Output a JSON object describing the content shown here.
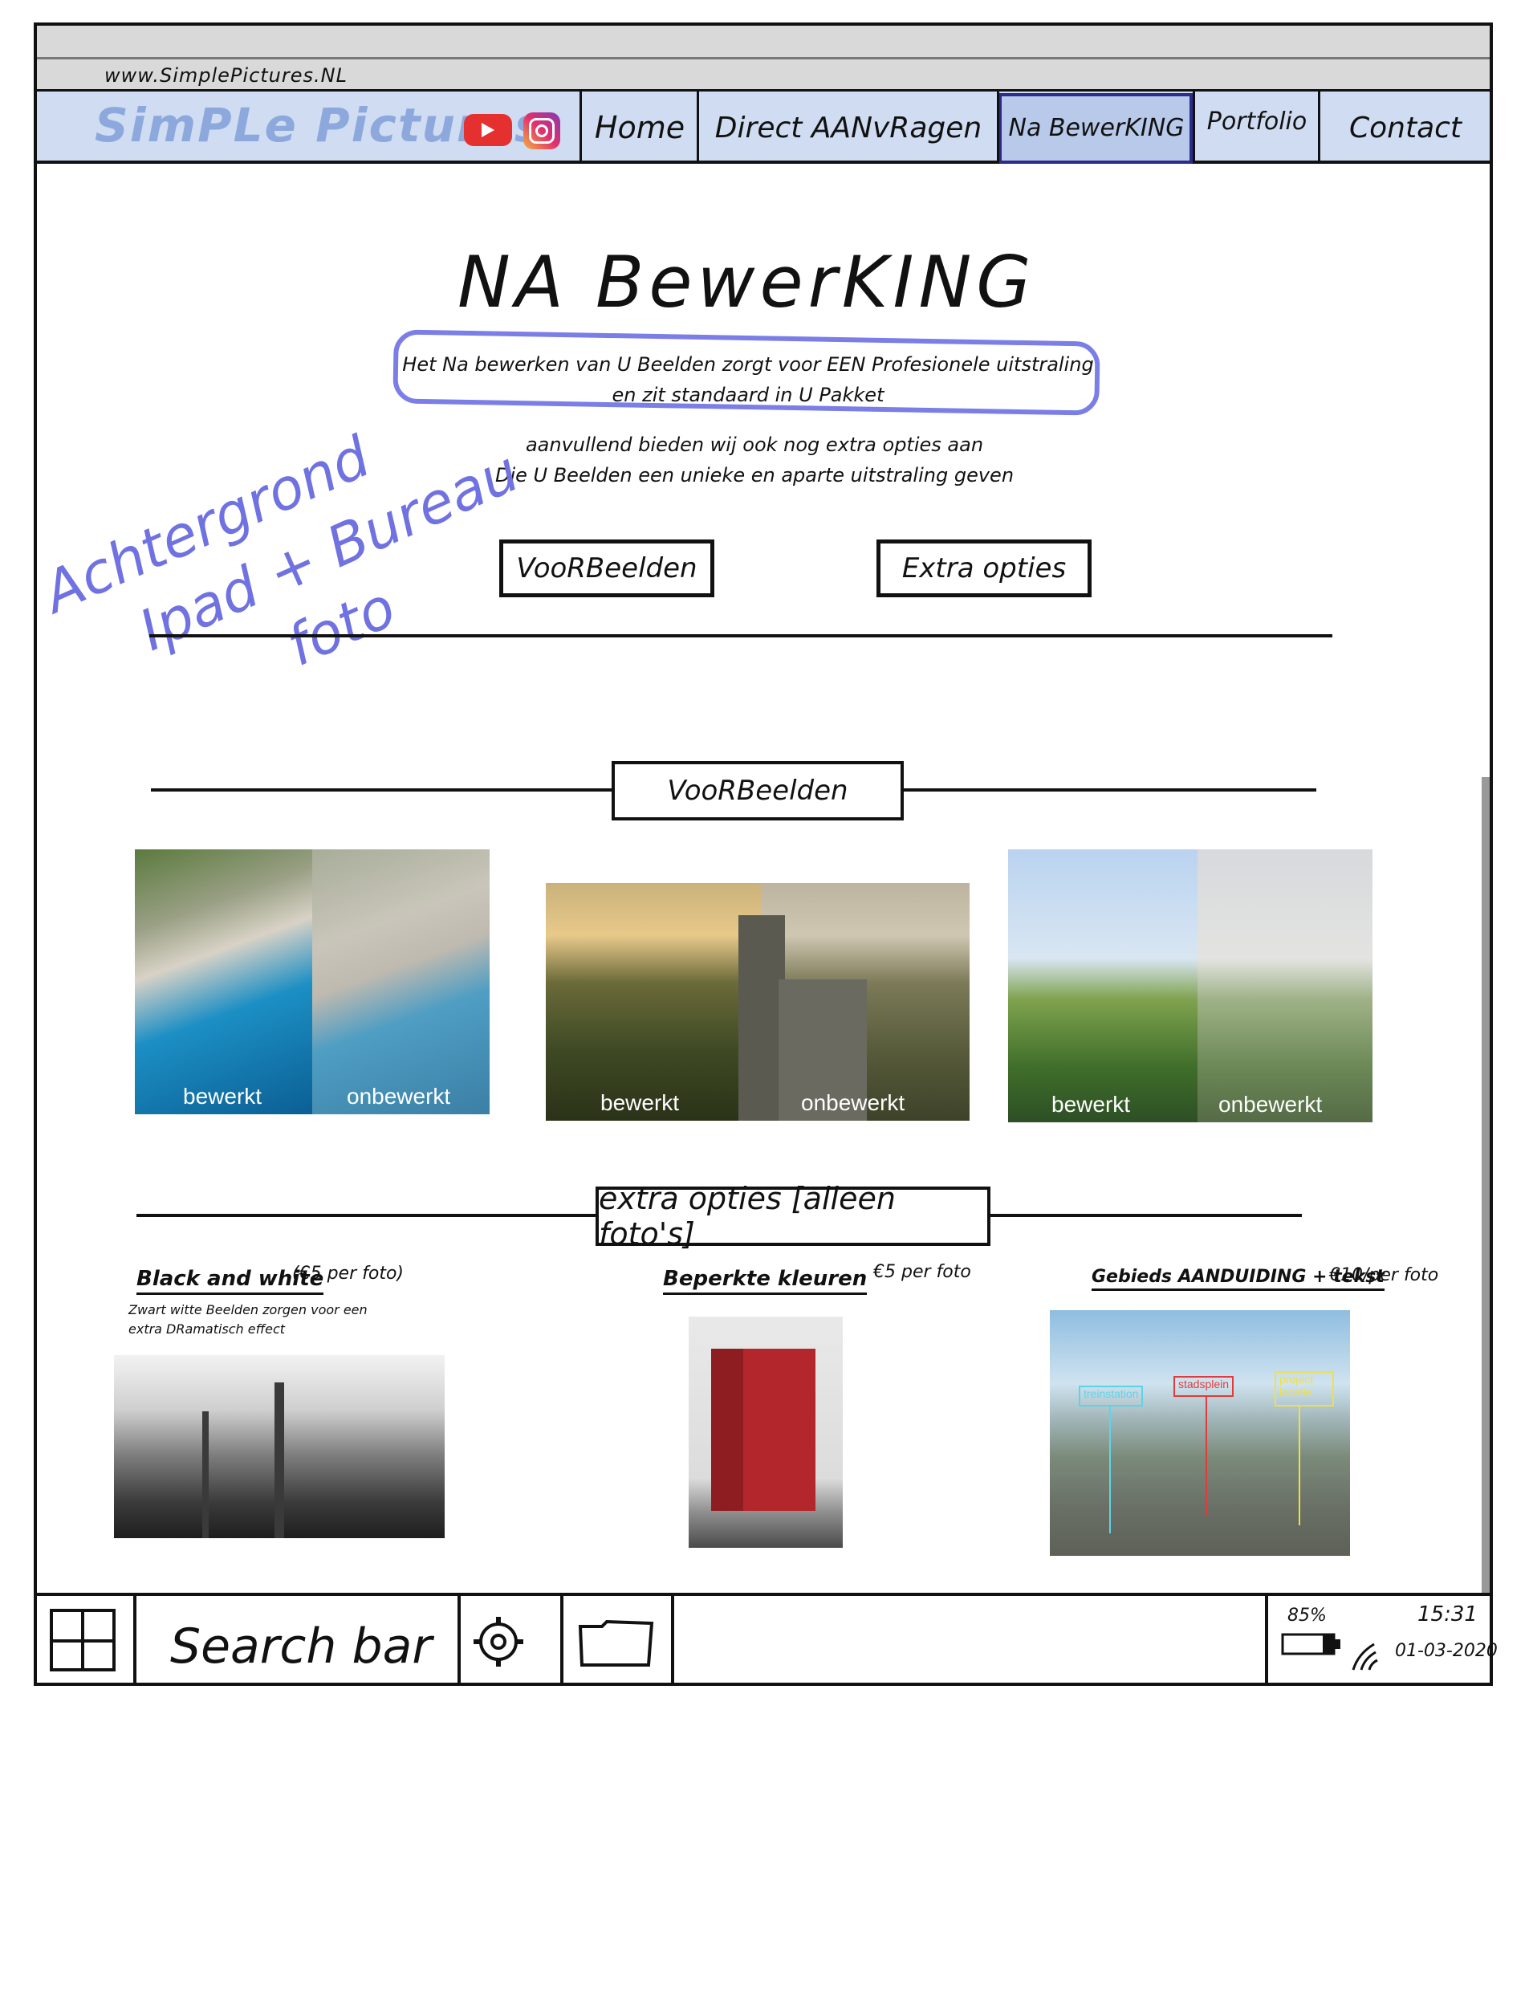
{
  "browser": {
    "url": "www.SimplePictures.NL"
  },
  "nav": {
    "logo": "SimPLe Pictures",
    "youtube_icon": "youtube-icon",
    "instagram_icon": "instagram-icon",
    "items": [
      "Home",
      "Direct AANvRagen",
      "Na BewerKING",
      "Portfolio",
      "Contact"
    ],
    "active_index": 2,
    "colors": {
      "bar": "#cfdcf1",
      "logo": "#8da8dc",
      "active_border": "#2b2b8c"
    }
  },
  "hero": {
    "title": "NA BewerKING",
    "line1": "Het Na bewerken van U Beelden zorgt voor EEN Profesionele uitstraling",
    "line2": "en zit standaard in U Pakket",
    "line3": "aanvullend bieden wij ook nog extra opties aan",
    "line4": "Die U Beelden een unieke en aparte uitstraling geven"
  },
  "annotation": {
    "lines": [
      "Achtergrond",
      "Ipad + Bureau",
      "foto"
    ],
    "color": "#6f72e0"
  },
  "buttons": {
    "voorbeelden": "VooRBeelden",
    "extra": "Extra opties"
  },
  "voorbeelden": {
    "heading": "VooRBeelden",
    "items": [
      {
        "left": "bewerkt",
        "right": "onbewerkt"
      },
      {
        "left": "bewerkt",
        "right": "onbewerkt"
      },
      {
        "left": "bewerkt",
        "right": "onbewerkt"
      }
    ]
  },
  "extra_opties": {
    "heading": "extra opties [alleen foto's]",
    "options": [
      {
        "label": "Black and white",
        "price": "(€5 per foto)",
        "desc1": "Zwart witte Beelden zorgen voor een",
        "desc2": "extra DRamatisch effect"
      },
      {
        "label": "Beperkte kleuren",
        "price": "€5 per foto"
      },
      {
        "label": "Gebieds AANDUIDING + tekst",
        "price": "€10/per foto"
      }
    ],
    "map_labels": [
      "treinstation",
      "stadsplein",
      "project locatie"
    ]
  },
  "taskbar": {
    "start_icon": "windows-icon",
    "search": "Search bar",
    "settings_icon": "gear-icon",
    "folder_icon": "folder-icon",
    "battery": "85%",
    "time": "15:31",
    "date": "01-03-2020"
  }
}
